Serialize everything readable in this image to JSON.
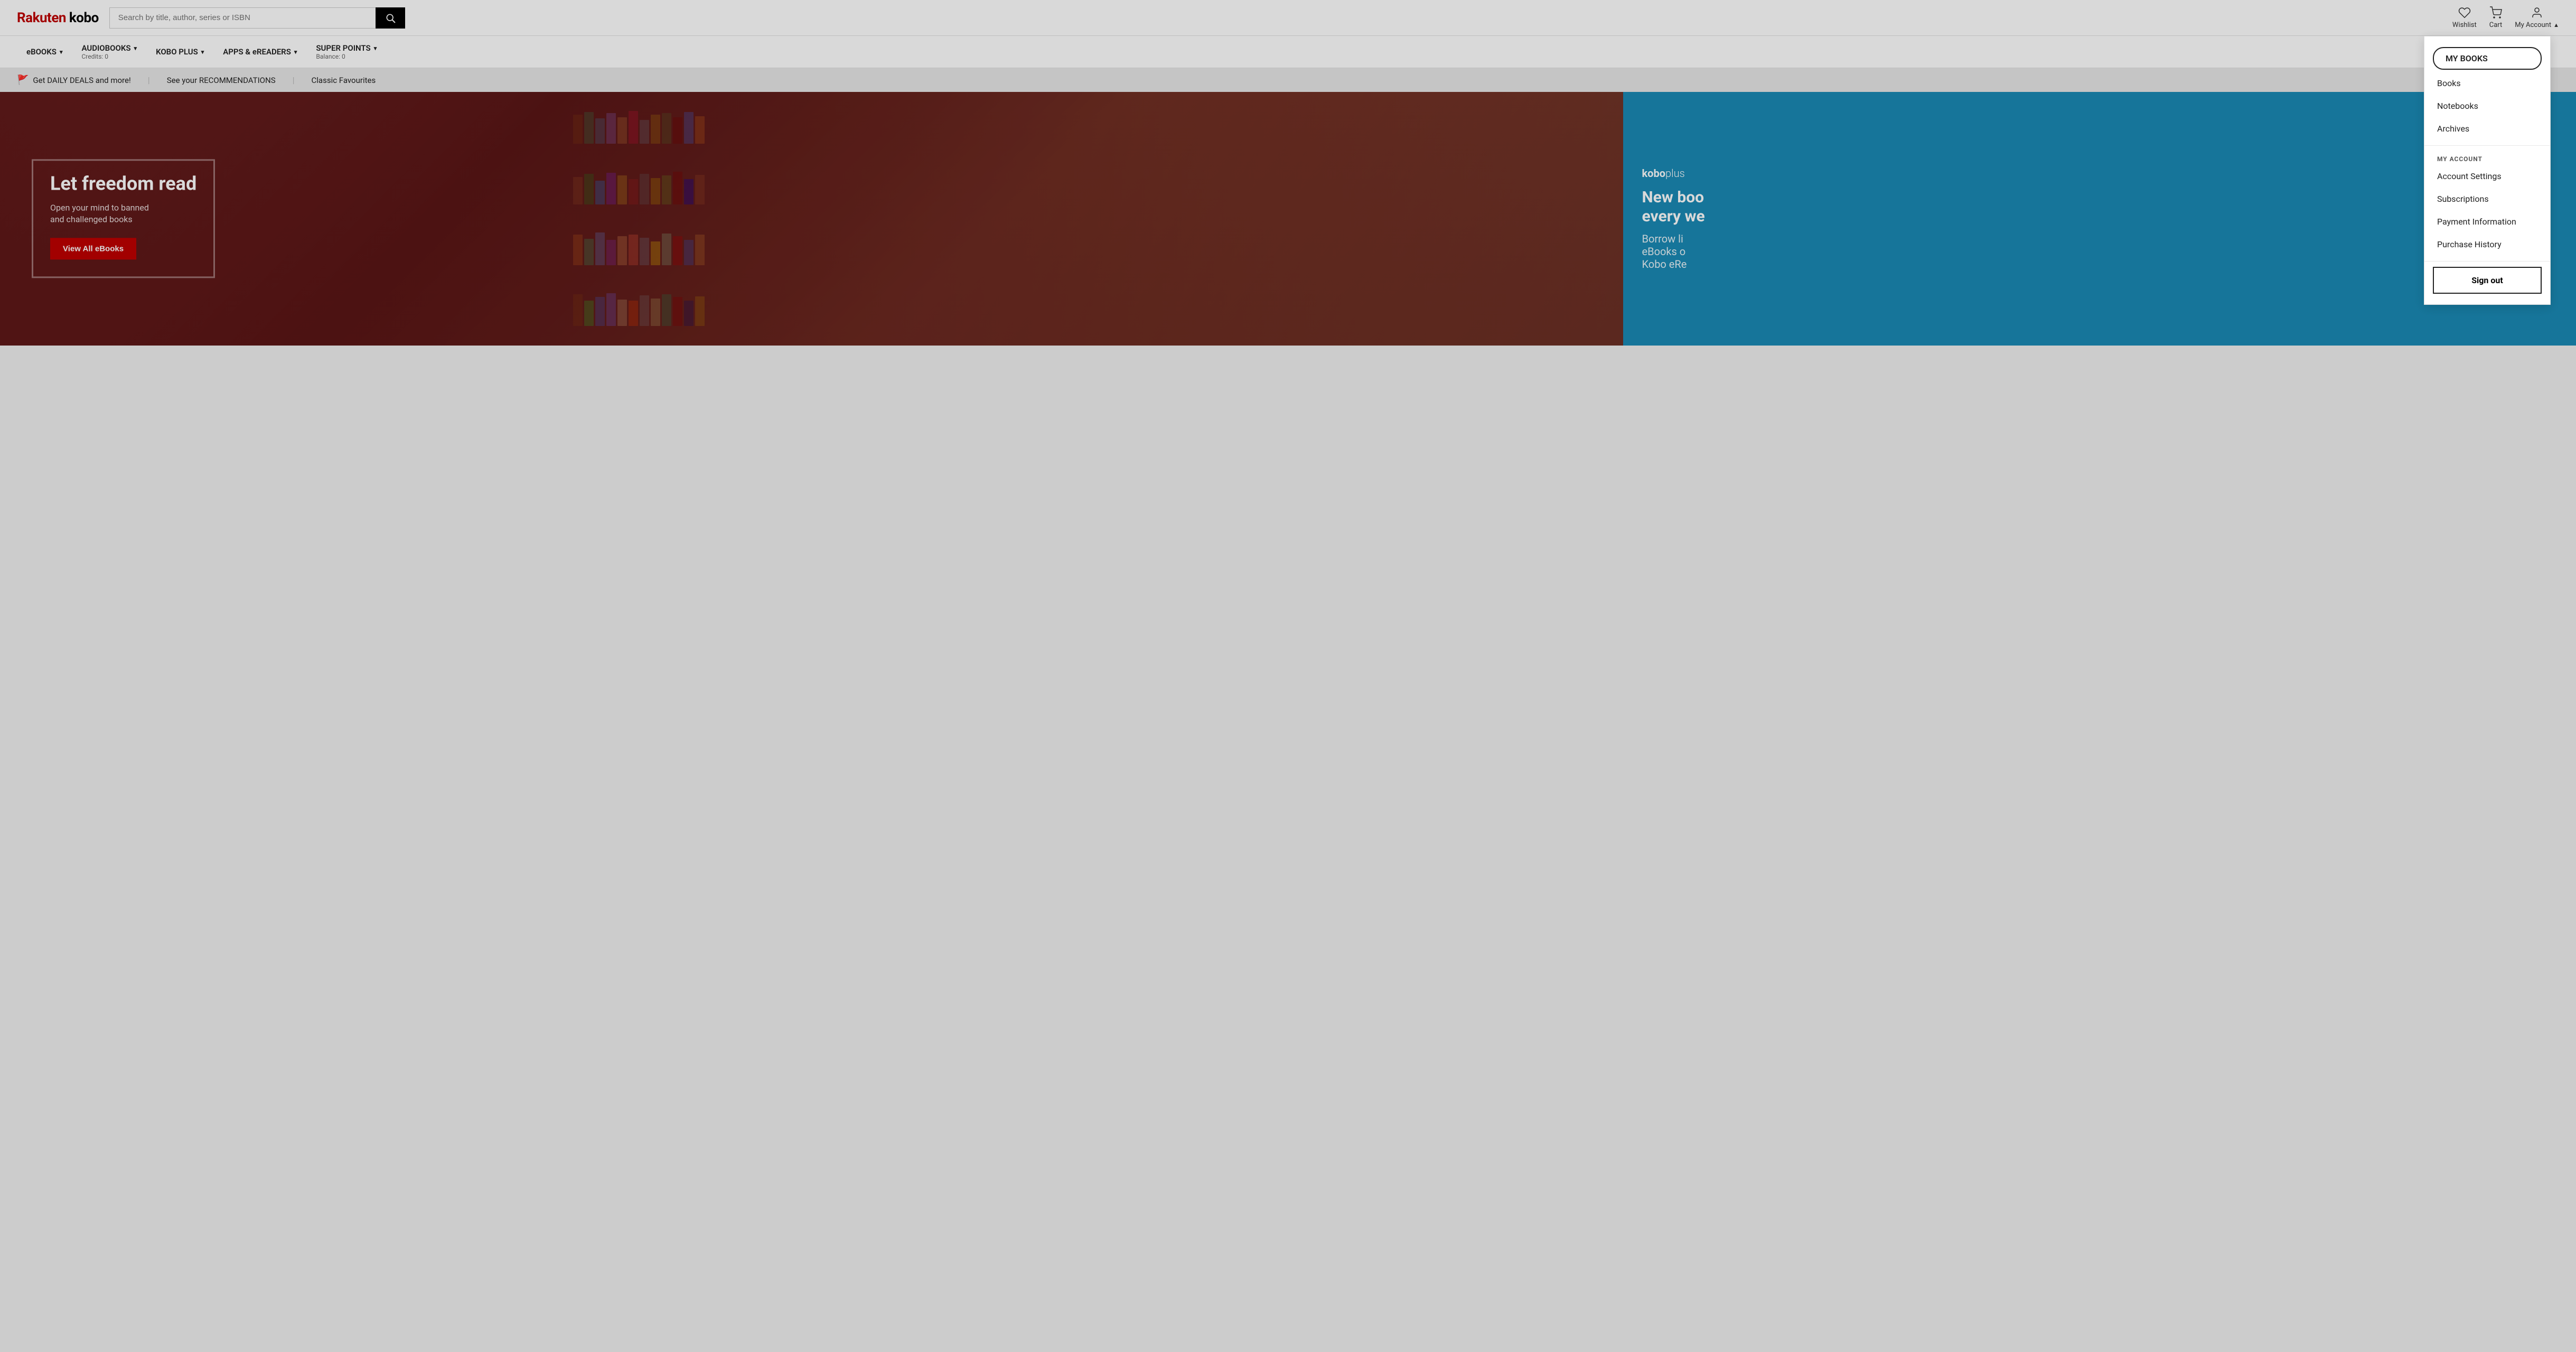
{
  "header": {
    "logo": "Rakuten kobo",
    "logo_rakuten": "Rakuten",
    "logo_kobo": "kobo",
    "search_placeholder": "Search by title, author, series or ISBN",
    "wishlist_label": "Wishlist",
    "cart_label": "Cart",
    "my_account_label": "My Account"
  },
  "nav": {
    "items": [
      {
        "label": "eBOOKS",
        "sub": "",
        "has_chevron": true
      },
      {
        "label": "AUDIOBOOKS",
        "sub": "Credits: 0",
        "has_chevron": true
      },
      {
        "label": "KOBO PLUS",
        "sub": "",
        "has_chevron": true
      },
      {
        "label": "APPS & eREADERS",
        "sub": "",
        "has_chevron": true
      },
      {
        "label": "SUPER POINTS",
        "sub": "Balance: 0",
        "has_chevron": true
      }
    ]
  },
  "promo_bar": {
    "items": [
      {
        "text": "Get DAILY DEALS and more!",
        "has_flag": true
      },
      {
        "text": "See your RECOMMENDATIONS",
        "has_flag": false
      },
      {
        "text": "Classic Favourites",
        "has_flag": false
      }
    ]
  },
  "hero": {
    "title": "Let freedom read",
    "subtitle": "Open your mind to banned\nand challenged books",
    "cta_label": "View All eBooks"
  },
  "right_panel": {
    "kobo_label": "kobo",
    "plus_label": "plus",
    "title_line1": "New boo",
    "title_line2": "every we",
    "sub_line1": "Borrow li",
    "sub_line2": "eBooks o",
    "sub_line3": "Kobo eRe"
  },
  "dropdown": {
    "my_books_label": "MY BOOKS",
    "my_books_active": "MY BOOKS",
    "books_label": "Books",
    "notebooks_label": "Notebooks",
    "archives_label": "Archives",
    "my_account_section": "MY ACCOUNT",
    "account_settings_label": "Account Settings",
    "subscriptions_label": "Subscriptions",
    "payment_information_label": "Payment Information",
    "purchase_history_label": "Purchase History",
    "sign_out_label": "Sign out"
  },
  "books": [
    {
      "color": "#8B4513"
    },
    {
      "color": "#2E8B57"
    },
    {
      "color": "#4682B4"
    },
    {
      "color": "#9370DB"
    },
    {
      "color": "#CD853F"
    },
    {
      "color": "#DC143C"
    },
    {
      "color": "#708090"
    },
    {
      "color": "#B8860B"
    },
    {
      "color": "#556B2F"
    },
    {
      "color": "#800000"
    },
    {
      "color": "#4169E1"
    },
    {
      "color": "#D2691E"
    }
  ]
}
